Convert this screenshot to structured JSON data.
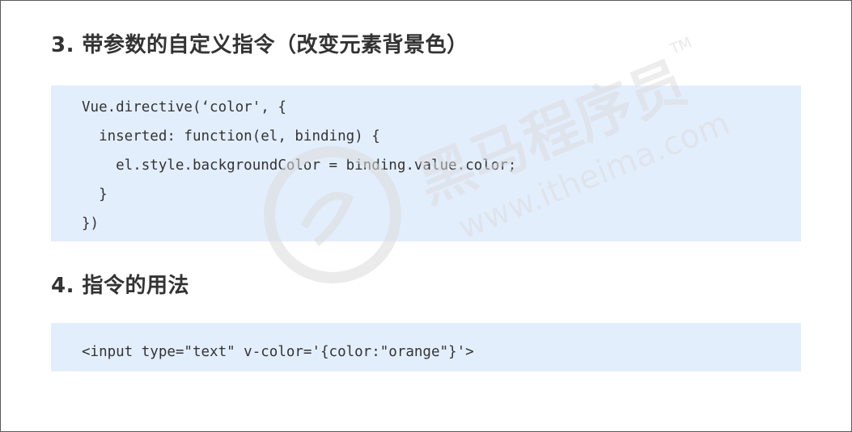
{
  "section3": {
    "title": "3. 带参数的自定义指令（改变元素背景色）",
    "code_lines": [
      "Vue.directive(‘color', {",
      "  inserted: function(el, binding) {",
      "    el.style.backgroundColor = binding.value.color;",
      "  }",
      "})"
    ]
  },
  "section4": {
    "title": "4. 指令的用法",
    "code_lines": [
      "<input type=\"text\" v-color='{color:\"orange\"}'>"
    ]
  },
  "watermark": {
    "brand": "黑马程序员",
    "url": "www.itheima.com",
    "trademark": "TM"
  }
}
